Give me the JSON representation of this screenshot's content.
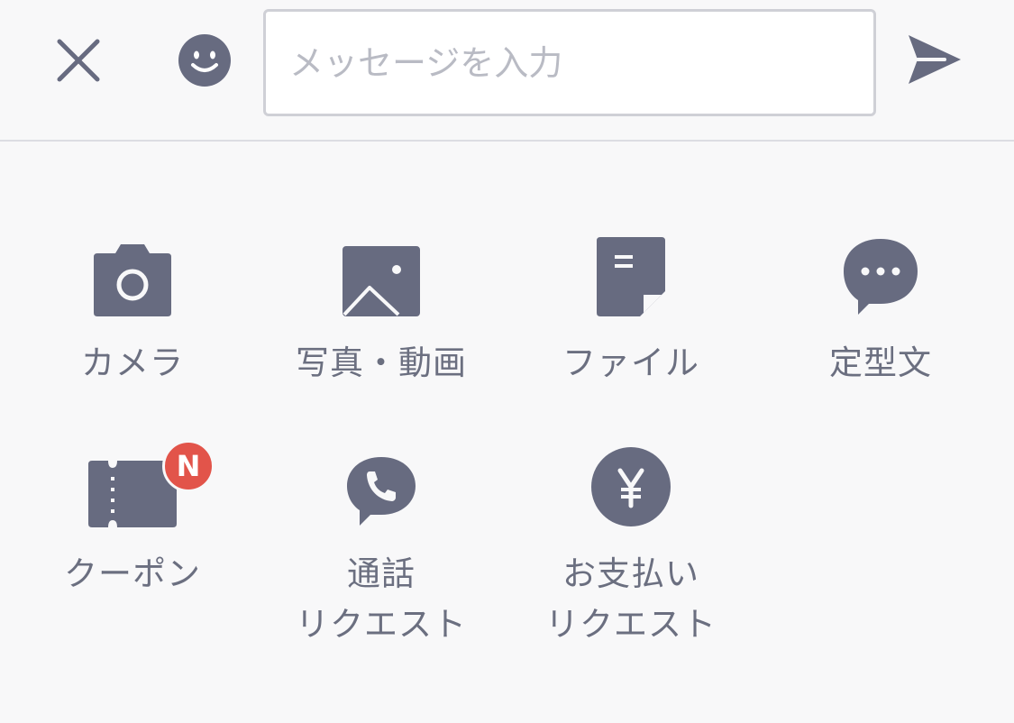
{
  "composer": {
    "close_icon": "close-icon",
    "emoji_icon": "smiley-icon",
    "input_placeholder": "メッセージを入力",
    "input_value": "",
    "send_icon": "send-icon"
  },
  "menu": {
    "items": [
      {
        "label": "カメラ",
        "icon": "camera-icon"
      },
      {
        "label": "写真・動画",
        "icon": "image-icon"
      },
      {
        "label": "ファイル",
        "icon": "file-icon"
      },
      {
        "label": "定型文",
        "icon": "speech-bubble-dots-icon"
      },
      {
        "label": "クーポン",
        "icon": "ticket-icon",
        "badge": "N"
      },
      {
        "label": "通話\nリクエスト",
        "icon": "phone-bubble-icon"
      },
      {
        "label": "お支払い\nリクエスト",
        "icon": "yen-coin-icon"
      }
    ]
  },
  "colors": {
    "icon": "#676b80",
    "background": "#f8f8f9",
    "badge": "#e2544a",
    "input_border": "#cfd0d6"
  }
}
